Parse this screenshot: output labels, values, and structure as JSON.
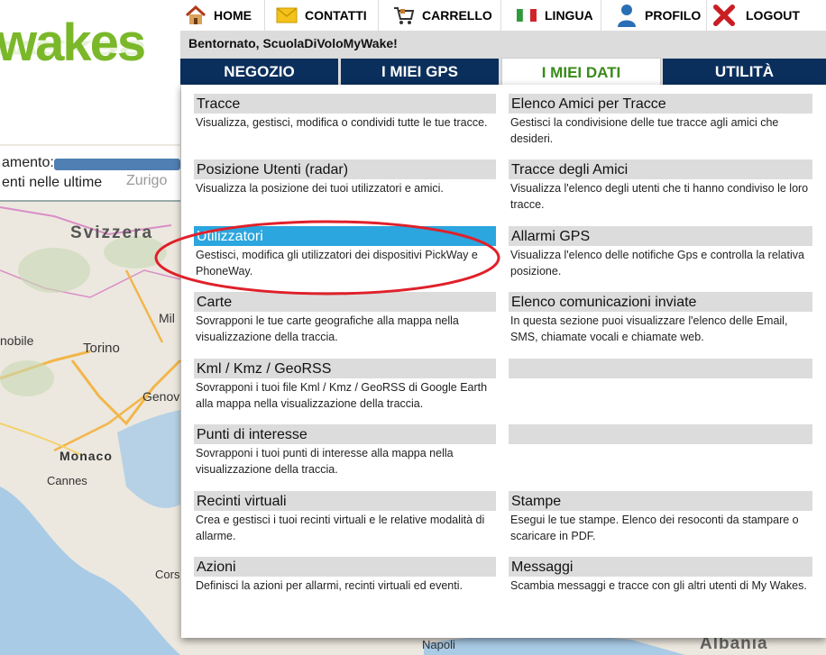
{
  "topnav": {
    "items": [
      {
        "label": "HOME",
        "icon": "home-icon"
      },
      {
        "label": "CONTATTI",
        "icon": "envelope-icon"
      },
      {
        "label": "CARRELLO",
        "icon": "cart-icon"
      },
      {
        "label": "LINGUA",
        "icon": "flag-italy-icon"
      },
      {
        "label": "PROFILO",
        "icon": "user-icon"
      },
      {
        "label": "LOGOUT",
        "icon": "close-icon"
      }
    ]
  },
  "welcome": "Bentornato, ScuolaDiVoloMyWake!",
  "logo": "wakes",
  "track_panel": {
    "line1": "amento:",
    "line2": "enti nelle ultime",
    "ghost": "Zurigo"
  },
  "tabs": [
    {
      "label": "NEGOZIO",
      "active": false
    },
    {
      "label": "I MIEI GPS",
      "active": false
    },
    {
      "label": "I MIEI DATI",
      "active": true
    },
    {
      "label": "UTILITÀ",
      "active": false
    }
  ],
  "menu": {
    "left": [
      {
        "title": "Tracce",
        "desc": "Visualizza, gestisci, modifica o condividi tutte le tue tracce."
      },
      {
        "title": "Posizione Utenti (radar)",
        "desc": "Visualizza la posizione dei tuoi utilizzatori e amici."
      },
      {
        "title": "Utilizzatori",
        "desc": "Gestisci, modifica gli utilizzatori dei dispositivi PickWay e PhoneWay.",
        "selected": true
      },
      {
        "title": "Carte",
        "desc": "Sovrapponi le tue carte geografiche alla mappa nella visualizzazione della traccia."
      },
      {
        "title": "Kml / Kmz / GeoRSS",
        "desc": "Sovrapponi i tuoi file Kml / Kmz / GeoRSS di Google Earth alla mappa nella visualizzazione della traccia."
      },
      {
        "title": "Punti di interesse",
        "desc": "Sovrapponi i tuoi punti di interesse alla mappa nella visualizzazione della traccia."
      },
      {
        "title": "Recinti virtuali",
        "desc": "Crea e gestisci i tuoi recinti virtuali e le relative modalità di allarme."
      },
      {
        "title": "Azioni",
        "desc": "Definisci la azioni per allarmi, recinti virtuali ed eventi."
      }
    ],
    "right": [
      {
        "title": "Elenco Amici per Tracce",
        "desc": "Gestisci la condivisione delle tue tracce agli amici che desideri."
      },
      {
        "title": "Tracce degli Amici",
        "desc": "Visualizza l'elenco degli utenti che ti hanno condiviso le loro tracce."
      },
      {
        "title": "Allarmi GPS",
        "desc": "Visualizza l'elenco delle notifiche Gps e controlla la relativa posizione."
      },
      {
        "title": "Elenco comunicazioni inviate",
        "desc": "In questa sezione puoi visualizzare l'elenco delle Email, SMS, chiamate vocali e chiamate web."
      },
      {
        "title": "",
        "desc": ""
      },
      {
        "title": "",
        "desc": ""
      },
      {
        "title": "Stampe",
        "desc": "Esegui le tue stampe. Elenco dei resoconti da stampare o scaricare in PDF."
      },
      {
        "title": "Messaggi",
        "desc": "Scambia messaggi e tracce con gli altri utenti di My Wakes."
      }
    ]
  },
  "map": {
    "labels": [
      "Svizzera",
      "Mil",
      "nobile",
      "Torino",
      "Genov",
      "Monaco",
      "Cannes",
      "Cors",
      "Napoli",
      "Albania"
    ]
  },
  "colors": {
    "tab_bg": "#0b2f5c",
    "tab_active_text": "#3a8a1a",
    "selected_item": "#2ba6de",
    "highlight_circle": "#e0202a",
    "logo_green": "#7ab82a"
  }
}
